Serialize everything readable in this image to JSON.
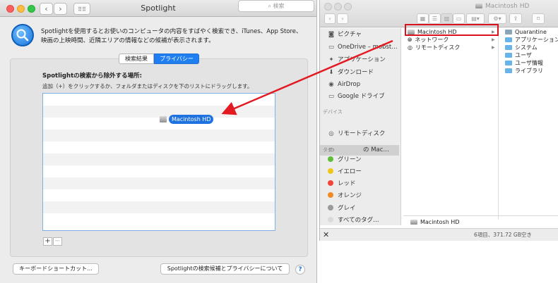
{
  "spotlight": {
    "title": "Spotlight",
    "search_placeholder": "検索",
    "description": "Spotlightを使用するとお使いのコンピュータの内容をすばやく検索でき、iTunes、App Store、映画の上映時間、近隣エリアの情報などの候補が表示されます。",
    "tabs": [
      "検索結果",
      "プライバシー"
    ],
    "privacy_heading": "Spotlightの検索から除外する場所:",
    "privacy_help": "追加（+）をクリックするか、フォルダまたはディスクを下のリストにドラッグします。",
    "dragged_item": "Macintosh HD",
    "add_label": "+",
    "remove_label": "−",
    "shortcut_button": "キーボードショートカット...",
    "about_button": "Spotlightの検索候補とプライバシーについて",
    "help_label": "?"
  },
  "finder": {
    "title": "Macintosh HD",
    "sidebar": {
      "favorites": [
        "ピクチャ",
        "OneDrive – mobst…",
        "アプリケーション",
        "ダウンロード",
        "AirDrop",
        "Google ドライブ"
      ],
      "devices_heading": "デバイス",
      "devices": [
        "の Mac…",
        "リモートディスク"
      ],
      "tags_heading": "タグ",
      "tags": [
        {
          "label": "グリーン",
          "color": "#5fbf3a"
        },
        {
          "label": "イエロー",
          "color": "#f0c519"
        },
        {
          "label": "レッド",
          "color": "#f0453a"
        },
        {
          "label": "オレンジ",
          "color": "#f28a27"
        },
        {
          "label": "グレイ",
          "color": "#9a9a9a"
        },
        {
          "label": "すべてのタグ…",
          "color": "#dadada"
        }
      ]
    },
    "column1": [
      "Macintosh HD",
      "ネットワーク",
      "リモートディスク"
    ],
    "column2": [
      "Quarantine",
      "アプリケーション",
      "システム",
      "ユーザ",
      "ユーザ情報",
      "ライブラリ"
    ],
    "pathbar": "Macintosh HD",
    "status": "6項目、371.72 GB空き",
    "close_glyph": "✕"
  },
  "colors": {
    "accent": "#1f73e0",
    "highlight_box": "#d9121b",
    "arrow": "#e31a22"
  }
}
